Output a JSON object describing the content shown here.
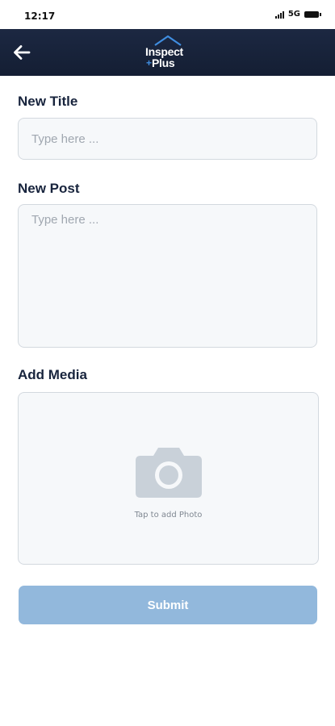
{
  "status_bar": {
    "time": "12:17",
    "network": "5G"
  },
  "header": {
    "back_icon": "arrow-left-icon",
    "logo": {
      "line1": "Inspect",
      "line2": "Plus",
      "plus_mark": "+"
    },
    "colors": {
      "background": "#1a2540",
      "logo_accent": "#3f8de0"
    }
  },
  "form": {
    "title": {
      "label": "New Title",
      "value": "",
      "placeholder": "Type here ..."
    },
    "post": {
      "label": "New Post",
      "value": "",
      "placeholder": "Type here ..."
    },
    "media": {
      "label": "Add Media",
      "icon": "camera-icon",
      "hint": "Tap to add Photo"
    },
    "submit_label": "Submit"
  },
  "colors": {
    "label_text": "#18243d",
    "submit_disabled": "#92b8dc",
    "field_border": "#d3d9df"
  }
}
